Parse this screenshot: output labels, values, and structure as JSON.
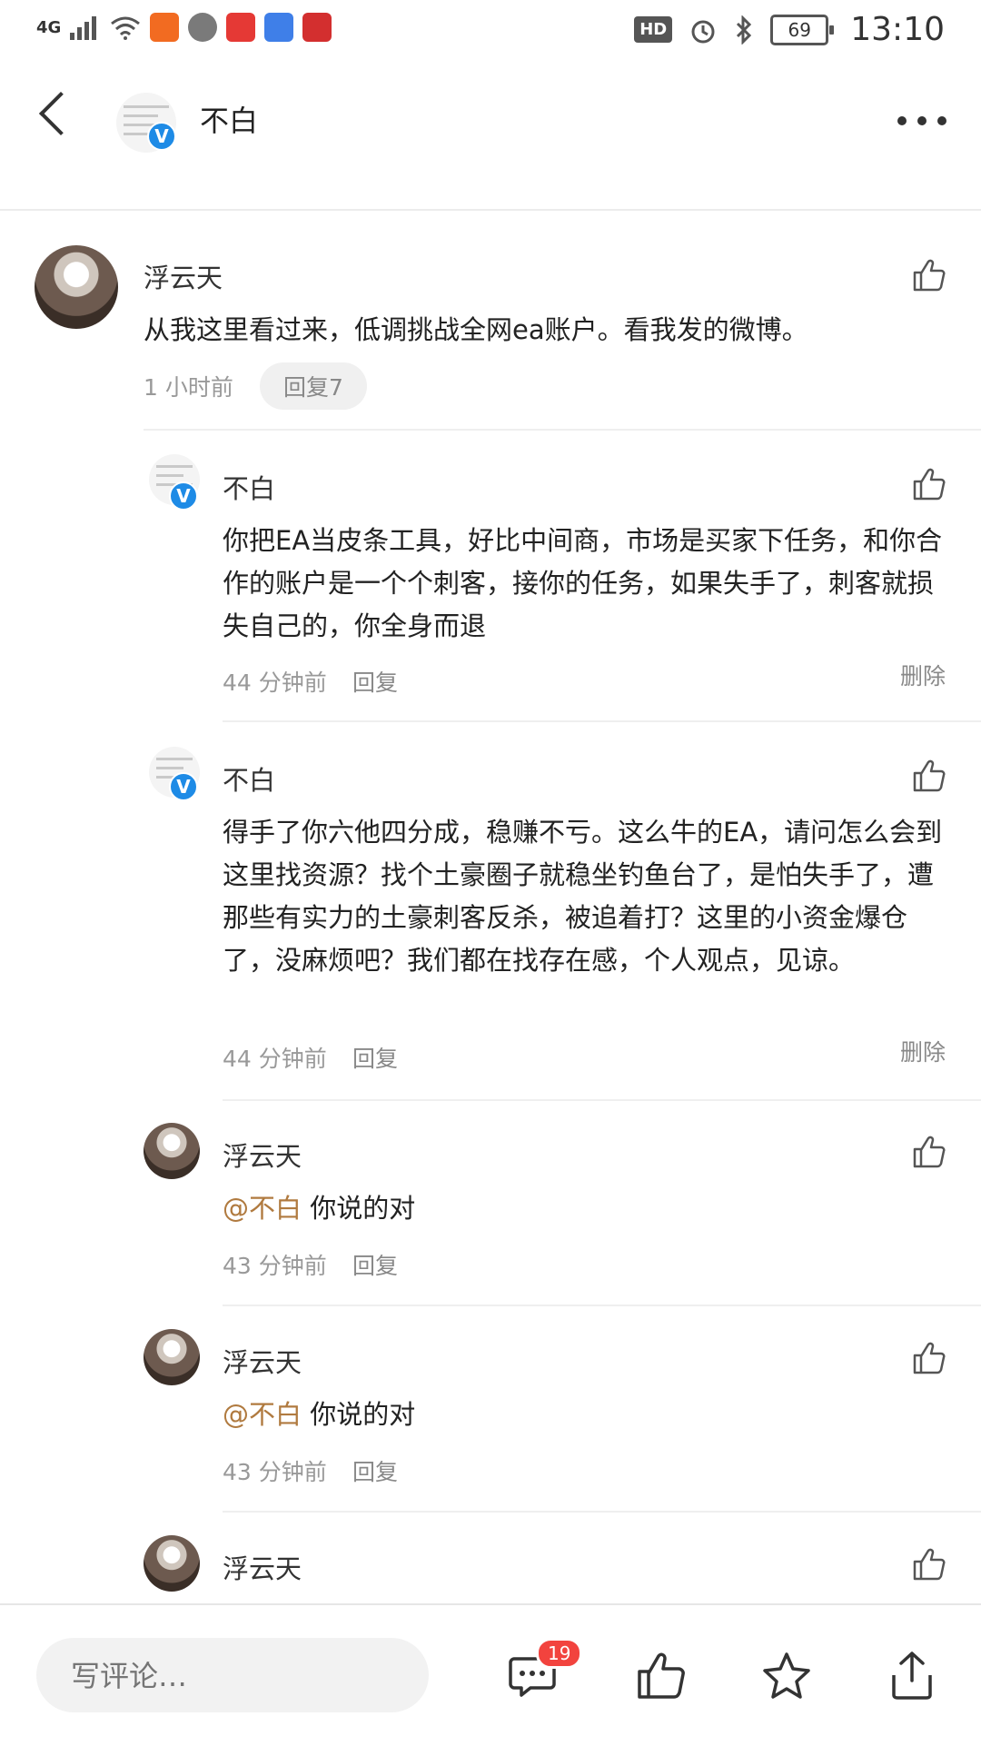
{
  "status_bar": {
    "network": "4G",
    "battery": "69",
    "time": "13:10",
    "hd": "HD"
  },
  "header": {
    "title": "不白",
    "verified": "V"
  },
  "comments": [
    {
      "name": "浮云天",
      "text": "从我这里看过来，低调挑战全网ea账户。看我发的微博。",
      "time": "1 小时前",
      "reply_label": "回复7"
    }
  ],
  "replies": [
    {
      "name": "不白",
      "text": "你把EA当皮条工具，好比中间商，市场是买家下任务，和你合作的账户是一个个刺客，接你的任务，如果失手了，刺客就损失自己的，你全身而退",
      "time": "44 分钟前",
      "reply_label": "回复",
      "delete_label": "删除"
    },
    {
      "name": "不白",
      "text": "得手了你六他四分成，稳赚不亏。这么牛的EA，请问怎么会到这里找资源？找个土豪圈子就稳坐钓鱼台了，是怕失手了，遭那些有实力的土豪刺客反杀，被追着打？这里的小资金爆仓了，没麻烦吧？我们都在找存在感，个人观点，见谅。",
      "time": "44 分钟前",
      "reply_label": "回复",
      "delete_label": "删除"
    },
    {
      "name": "浮云天",
      "mention": "@不白",
      "text": "你说的对",
      "time": "43 分钟前",
      "reply_label": "回复"
    },
    {
      "name": "浮云天",
      "mention": "@不白",
      "text": "你说的对",
      "time": "43 分钟前",
      "reply_label": "回复"
    },
    {
      "name": "浮云天"
    }
  ],
  "bottom_bar": {
    "input_placeholder": "写评论…",
    "comment_count": "19"
  },
  "icons": [
    "back-icon",
    "more-icon",
    "thumbs-up-icon",
    "comment-icon",
    "star-icon",
    "share-icon"
  ]
}
